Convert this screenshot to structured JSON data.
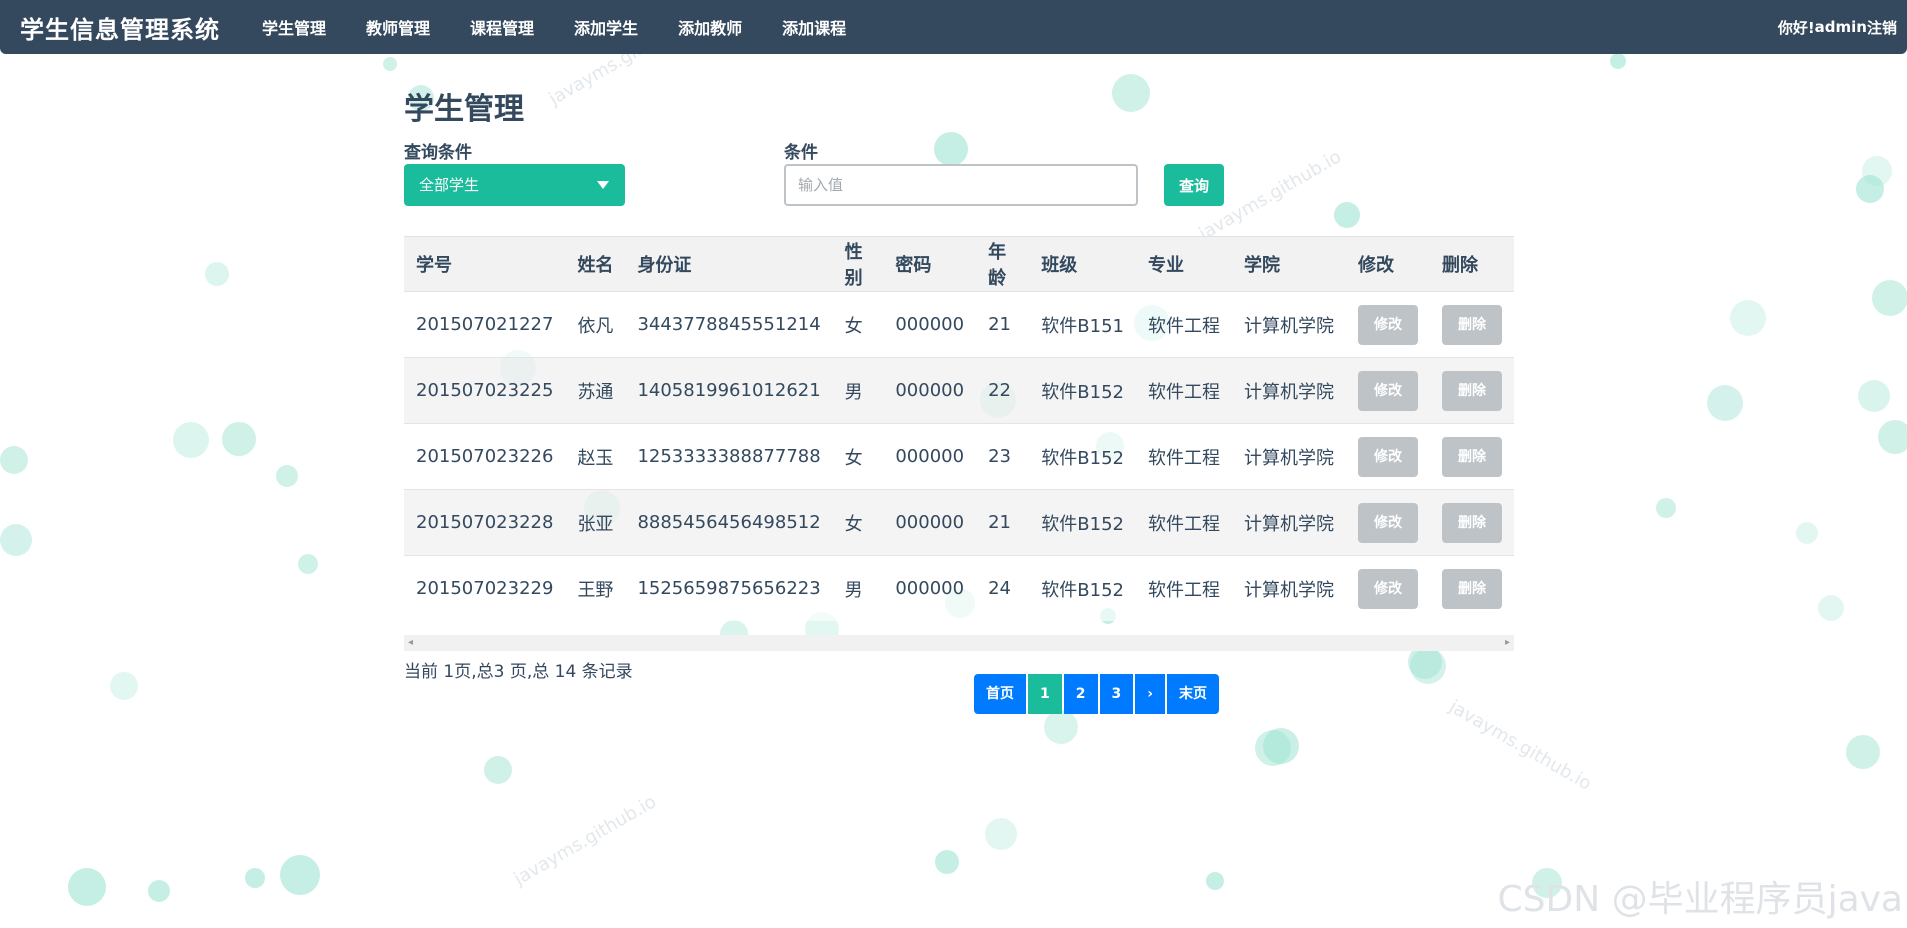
{
  "navbar": {
    "brand": "学生信息管理系统",
    "items": [
      "学生管理",
      "教师管理",
      "课程管理",
      "添加学生",
      "添加教师",
      "添加课程"
    ],
    "greeting": "你好!",
    "user": "admin",
    "logout": "注销"
  },
  "page": {
    "title": "学生管理"
  },
  "filter": {
    "condition_label": "查询条件",
    "condition_value": "全部学生",
    "value_label": "条件",
    "value_placeholder": "输入值",
    "query_button": "查询"
  },
  "table": {
    "columns": [
      "学号",
      "姓名",
      "身份证",
      "性别",
      "密码",
      "年龄",
      "班级",
      "专业",
      "学院",
      "修改",
      "删除"
    ],
    "edit_label": "修改",
    "delete_label": "删除",
    "rows": [
      [
        "201507021227",
        "依凡",
        "3443778845551214",
        "女",
        "000000",
        "21",
        "软件B151",
        "软件工程",
        "计算机学院"
      ],
      [
        "201507023225",
        "苏通",
        "1405819961012621",
        "男",
        "000000",
        "22",
        "软件B152",
        "软件工程",
        "计算机学院"
      ],
      [
        "201507023226",
        "赵玉",
        "1253333388877788",
        "女",
        "000000",
        "23",
        "软件B152",
        "软件工程",
        "计算机学院"
      ],
      [
        "201507023228",
        "张亚",
        "8885456456498512",
        "女",
        "000000",
        "21",
        "软件B152",
        "软件工程",
        "计算机学院"
      ],
      [
        "201507023229",
        "王野",
        "1525659875656223",
        "男",
        "000000",
        "24",
        "软件B152",
        "软件工程",
        "计算机学院"
      ]
    ]
  },
  "record_info": "当前 1页,总3 页,总 14 条记录",
  "pagination": {
    "first": "首页",
    "pages": [
      "1",
      "2",
      "3"
    ],
    "current": "1",
    "next": "›",
    "last": "末页"
  },
  "watermarks": {
    "site": "javayms.github.io",
    "csdn": "CSDN @毕业程序员java"
  },
  "colors": {
    "navbar": "#34495e",
    "primary": "#1abc9c",
    "pager": "#007bff",
    "disabled_button": "#bdc3c7",
    "bubble": "#9fe3d2"
  }
}
